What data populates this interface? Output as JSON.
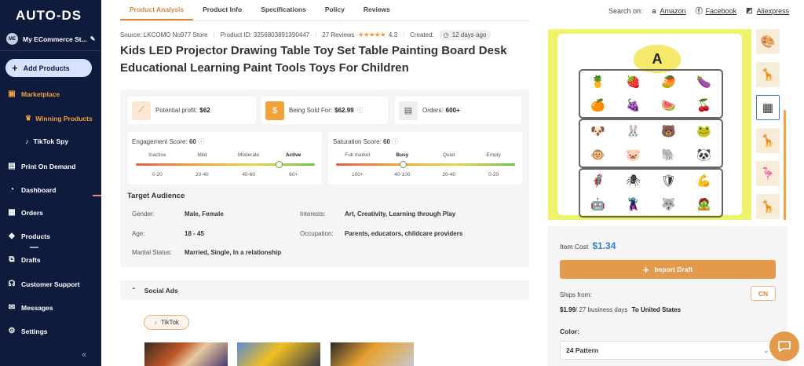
{
  "sidebar": {
    "logo": "AUTO-DS",
    "store": {
      "initials": "ME",
      "name": "My ECommerce St..."
    },
    "add_products": "Add Products",
    "items": [
      {
        "label": "Marketplace",
        "icon": "store-icon"
      },
      {
        "label": "Winning Products",
        "icon": "trophy-icon"
      },
      {
        "label": "TikTok Spy",
        "icon": "tiktok-icon"
      },
      {
        "label": "Print On Demand",
        "icon": "print-icon"
      },
      {
        "label": "Dashboard",
        "icon": "gauge-icon"
      },
      {
        "label": "Orders",
        "icon": "orders-icon"
      },
      {
        "label": "Products",
        "icon": "box-icon"
      },
      {
        "label": "Drafts",
        "icon": "drafts-icon"
      },
      {
        "label": "Customer Support",
        "icon": "headset-icon"
      },
      {
        "label": "Messages",
        "icon": "mail-icon"
      },
      {
        "label": "Settings",
        "icon": "gear-icon"
      }
    ],
    "collapse_glyph": "«"
  },
  "tabs": [
    "Product Analysis",
    "Product Info",
    "Specifications",
    "Policy",
    "Reviews"
  ],
  "search_on": {
    "label": "Search on:",
    "links": [
      "Amazon",
      "Facebook",
      "Aliexpress"
    ]
  },
  "meta": {
    "source": "Source: LKCOMO No977 Store",
    "product_id": "Product ID: 3256803891390447",
    "reviews": "27 Reviews",
    "rating": "4.3",
    "created_label": "Created:",
    "created_value": "12 days ago"
  },
  "title": "Kids LED Projector Drawing Table Toy Set Table Painting Board Desk Educational Learning Paint Tools Toys For Children",
  "cards": {
    "profit": {
      "label": "Potential profit:",
      "value": "$62"
    },
    "sold": {
      "label": "Being Sold For:",
      "value": "$62.99"
    },
    "orders": {
      "label": "Orders:",
      "value": "600+"
    }
  },
  "engagement": {
    "label": "Engagement Score:",
    "value": "60",
    "levels": [
      "Inactive",
      "Mild",
      "Moderate",
      "Active"
    ],
    "ranges": [
      "0-20",
      "20-40",
      "40-60",
      "60+"
    ],
    "active_level": "Active",
    "score_fraction": 0.8
  },
  "saturation": {
    "label": "Saturation Score:",
    "value": "60",
    "levels": [
      "Full market",
      "Busy",
      "Quiet",
      "Empty"
    ],
    "ranges": [
      "100+",
      "40-100",
      "20-40",
      "0-20"
    ],
    "active_level": "Busy",
    "score_fraction": 0.375
  },
  "audience": {
    "title": "Target Audience",
    "gender": {
      "label": "Gender:",
      "value": "Male, Female"
    },
    "age": {
      "label": "Age:",
      "value": "18 - 45"
    },
    "marital": {
      "label": "Marital Status:",
      "value": "Married, Single, In a relationship"
    },
    "interests": {
      "label": "Interests:",
      "value": "Art, Creativity, Learning through Play"
    },
    "occupation": {
      "label": "Occupation:",
      "value": "Parents, educators, childcare providers"
    }
  },
  "social": {
    "title": "Social Ads",
    "tiktok": "TikTok"
  },
  "image": {
    "letter": "A"
  },
  "price": {
    "item_cost_label": "Item Cost",
    "item_cost": "$1.34",
    "import_label": "Import Draft",
    "ships_from": "Ships from:",
    "country": "CN",
    "ship_price": "$1.99",
    "ship_days": "/ 27 business days",
    "ship_to": "To United States",
    "color_label": "Color:",
    "color_value": "24 Pattern"
  },
  "colors": {
    "accent": "#e0843a",
    "sidebar": "#0f1b3d",
    "link_blue": "#3a7bd5"
  }
}
